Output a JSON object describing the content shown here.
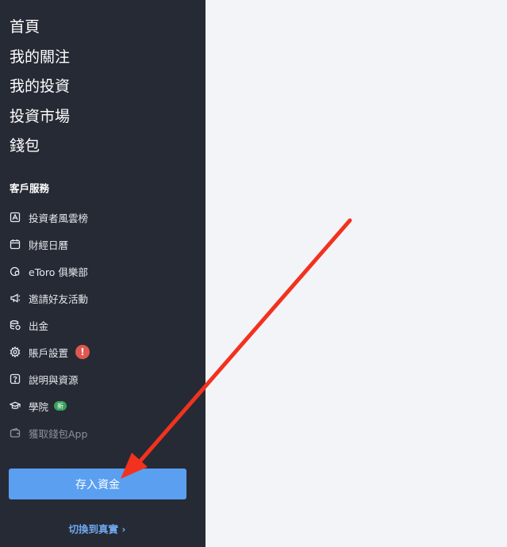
{
  "sidebar": {
    "main_nav": [
      {
        "label": "首頁"
      },
      {
        "label": "我的關注"
      },
      {
        "label": "我的投資"
      },
      {
        "label": "投資市場"
      },
      {
        "label": "錢包"
      }
    ],
    "services_title": "客戶服務",
    "services": [
      {
        "label": "投資者風雲榜",
        "icon": "leaderboard-icon"
      },
      {
        "label": "財經日曆",
        "icon": "calendar-icon"
      },
      {
        "label": "eToro 俱樂部",
        "icon": "club-icon"
      },
      {
        "label": "邀請好友活動",
        "icon": "megaphone-icon"
      },
      {
        "label": "出金",
        "icon": "coins-icon"
      },
      {
        "label": "賬戶設置",
        "icon": "gear-icon",
        "badge": "!"
      },
      {
        "label": "說明與資源",
        "icon": "help-icon"
      },
      {
        "label": "學院",
        "icon": "academy-icon",
        "badge": "新"
      },
      {
        "label": "獲取錢包App",
        "icon": "wallet-icon"
      }
    ],
    "deposit_button": "存入資金",
    "switch_link": "切換到真實 ›"
  },
  "colors": {
    "sidebar_bg": "#262a34",
    "main_bg": "#f3f4f8",
    "primary_button": "#5b9ff0",
    "link": "#6ea8ef",
    "alert_badge": "#e0574f",
    "new_badge": "#3aa05e",
    "annotation_arrow": "#f2321e"
  }
}
